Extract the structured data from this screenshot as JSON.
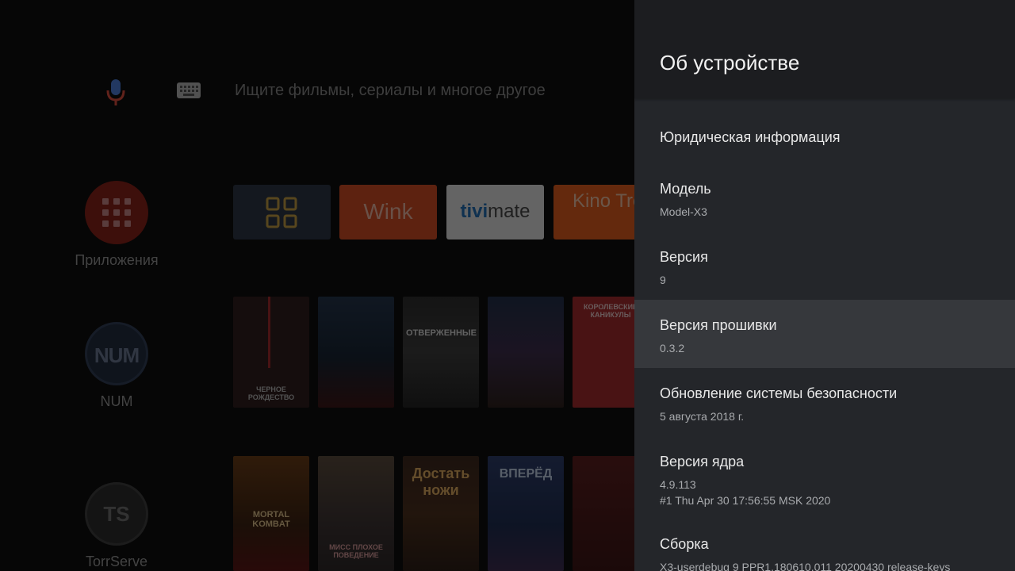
{
  "search": {
    "placeholder": "Ищите фильмы, сериалы и многое другое"
  },
  "sidebar": {
    "items": [
      {
        "label": "Приложения",
        "icon": "apps-grid-icon"
      },
      {
        "label": "NUM",
        "icon": "num-logo-icon"
      },
      {
        "label": "TorrServe",
        "icon": "torrserve-logo-icon"
      }
    ],
    "num_logo_text": "NUM",
    "ts_logo_text": "TS"
  },
  "app_tiles": [
    {
      "label": "",
      "icon": "all-apps-icon"
    },
    {
      "label": "Wink"
    },
    {
      "label_a": "tivi",
      "label_b": "mate"
    },
    {
      "label": "Kino Trend"
    }
  ],
  "posters_row1": [
    {
      "text": "ЧЕРНОЕ РОЖДЕСТВО"
    },
    {
      "text": ""
    },
    {
      "text": "ОТВЕРЖЕННЫЕ"
    },
    {
      "text": ""
    },
    {
      "text": "КОРОЛЕВСКИЕ КАНИКУЛЫ"
    }
  ],
  "posters_row2": [
    {
      "text": "MORTAL KOMBAT"
    },
    {
      "text": "МИСС ПЛОХОЕ ПОВЕДЕНИЕ"
    },
    {
      "text": "Достать ножи"
    },
    {
      "text": "ВПЕРЁД"
    },
    {
      "text": ""
    }
  ],
  "settings": {
    "title": "Об устройстве",
    "items": [
      {
        "title": "Юридическая информация",
        "sub": ""
      },
      {
        "title": "Модель",
        "sub": "Model-X3"
      },
      {
        "title": "Версия",
        "sub": "9"
      },
      {
        "title": "Версия прошивки",
        "sub": "0.3.2",
        "focused": true
      },
      {
        "title": "Обновление системы безопасности",
        "sub": "5 августа 2018 г."
      },
      {
        "title": "Версия ядра",
        "sub": "4.9.113",
        "sub2": "#1 Thu Apr 30 17:56:55 MSK 2020"
      },
      {
        "title": "Сборка",
        "sub": "X3-userdebug 9 PPR1.180610.011 20200430 release-keys"
      }
    ]
  },
  "colors": {
    "panel_bg": "#24262a",
    "panel_header_bg": "#1c1d20",
    "focused_bg": "#36383c",
    "wink_orange": "#d64a1f",
    "kinotrend_orange": "#e85b1a"
  }
}
